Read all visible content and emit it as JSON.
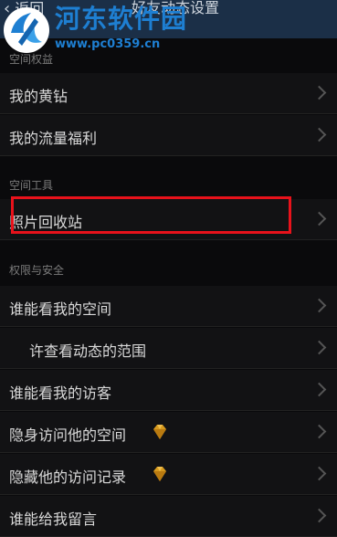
{
  "header": {
    "back_label": "返回",
    "title": "好友动态设置"
  },
  "watermark": {
    "title": "河东软件园",
    "url": "www.pc0359.cn"
  },
  "sections": {
    "space_perms": "空间权益",
    "space_tools": "空间工具",
    "privacy": "权限与安全"
  },
  "rows": {
    "yellow_diamond": "我的黄钻",
    "traffic_benefit": "我的流量福利",
    "photo_recycle": "照片回收站",
    "who_can_see": "谁能看我的空间",
    "dynamic_range": "许查看动态的范围",
    "who_can_visit": "谁能看我的访客",
    "hidden_visit": "隐身访问他的空间",
    "hide_records": "隐藏他的访问记录",
    "who_can_message": "谁能给我留言"
  },
  "colors": {
    "highlight": "#e8121b",
    "header_bg": "#1b2f47",
    "diamond": "#d79a1e",
    "watermark": "#1e7fd2"
  }
}
